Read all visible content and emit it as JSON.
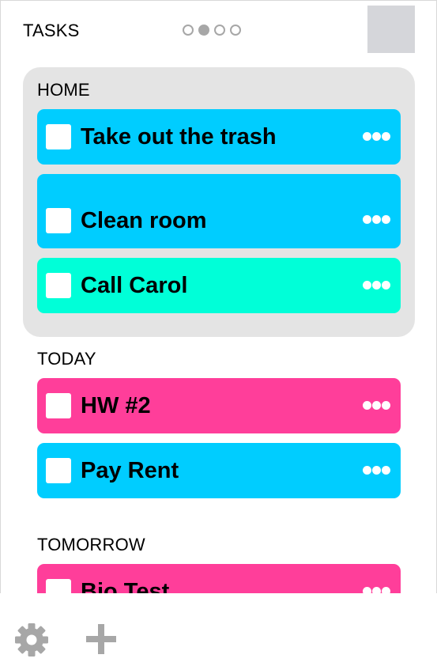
{
  "header": {
    "title": "TASKS",
    "page_dots": [
      {
        "active": false
      },
      {
        "active": true
      },
      {
        "active": false
      },
      {
        "active": false
      }
    ]
  },
  "sections": {
    "home": {
      "label": "HOME",
      "tasks": [
        {
          "name": "Take out the trash",
          "color": "#00cdff"
        },
        {
          "name": "Clean room",
          "color": "#00cdff"
        },
        {
          "name": "Call Carol",
          "color": "#00ffd8"
        }
      ]
    },
    "today": {
      "label": "TODAY",
      "tasks": [
        {
          "name": "HW #2",
          "color": "#ff3e9a"
        },
        {
          "name": "Pay Rent",
          "color": "#00cdff"
        }
      ]
    },
    "tomorrow": {
      "label": "TOMORROW",
      "tasks": [
        {
          "name": "Bio Test",
          "color": "#ff3e9a"
        }
      ]
    }
  },
  "footer": {
    "settings_icon": "gear-icon",
    "add_icon": "plus-icon"
  },
  "colors": {
    "cyan": "#00cdff",
    "aqua": "#00ffd8",
    "pink": "#ff3e9a",
    "panel": "#e4e4e4",
    "icon_gray": "#a7a7a7"
  }
}
